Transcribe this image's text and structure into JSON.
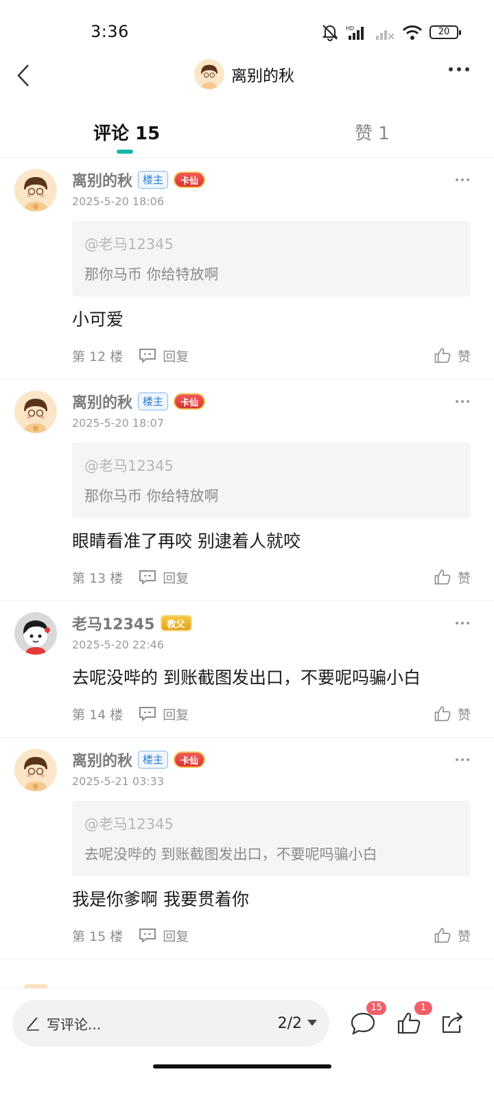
{
  "status_bar": {
    "time": "3:36",
    "battery": "20"
  },
  "nav": {
    "title": "离别的秋"
  },
  "tabs": {
    "comments": "评论 15",
    "likes": "赞 1"
  },
  "comments": [
    {
      "avatar": "boy-glasses",
      "name": "离别的秋",
      "owner_badge": "楼主",
      "level_badge": "卡仙",
      "level_style": "kaxian",
      "time": "2025-5-20 18:06",
      "quote_user": "@老马12345",
      "quote_text": "那你马币 你给特放啊",
      "text": "小可爱",
      "floor": "第 12 楼",
      "reply": "回复",
      "like": "赞"
    },
    {
      "avatar": "boy-glasses",
      "name": "离别的秋",
      "owner_badge": "楼主",
      "level_badge": "卡仙",
      "level_style": "kaxian",
      "time": "2025-5-20 18:07",
      "quote_user": "@老马12345",
      "quote_text": "那你马币 你给特放啊",
      "text": "眼睛看准了再咬  别逮着人就咬",
      "floor": "第 13 楼",
      "reply": "回复",
      "like": "赞"
    },
    {
      "avatar": "cartoon-girl",
      "name": "老马12345",
      "owner_badge": "",
      "level_badge": "教父",
      "level_style": "jiaofu",
      "time": "2025-5-20 22:46",
      "quote_user": "",
      "quote_text": "",
      "text": "去呢没哔的 到账截图发出口，不要呢吗骗小白",
      "floor": "第 14 楼",
      "reply": "回复",
      "like": "赞"
    },
    {
      "avatar": "boy-glasses",
      "name": "离别的秋",
      "owner_badge": "楼主",
      "level_badge": "卡仙",
      "level_style": "kaxian",
      "time": "2025-5-21 03:33",
      "quote_user": "@老马12345",
      "quote_text": "去呢没哔的 到账截图发出口，不要呢吗骗小白",
      "text": "我是你爹啊  我要贯着你",
      "floor": "第 15 楼",
      "reply": "回复",
      "like": "赞"
    }
  ],
  "bottom_bar": {
    "write_placeholder": "写评论...",
    "page_indicator": "2/2",
    "comment_count": "15",
    "like_count": "1"
  },
  "colors": {
    "accent": "#14b8a6",
    "badge_red": "#f05f6a",
    "owner_blue": "#2a7fd4"
  }
}
